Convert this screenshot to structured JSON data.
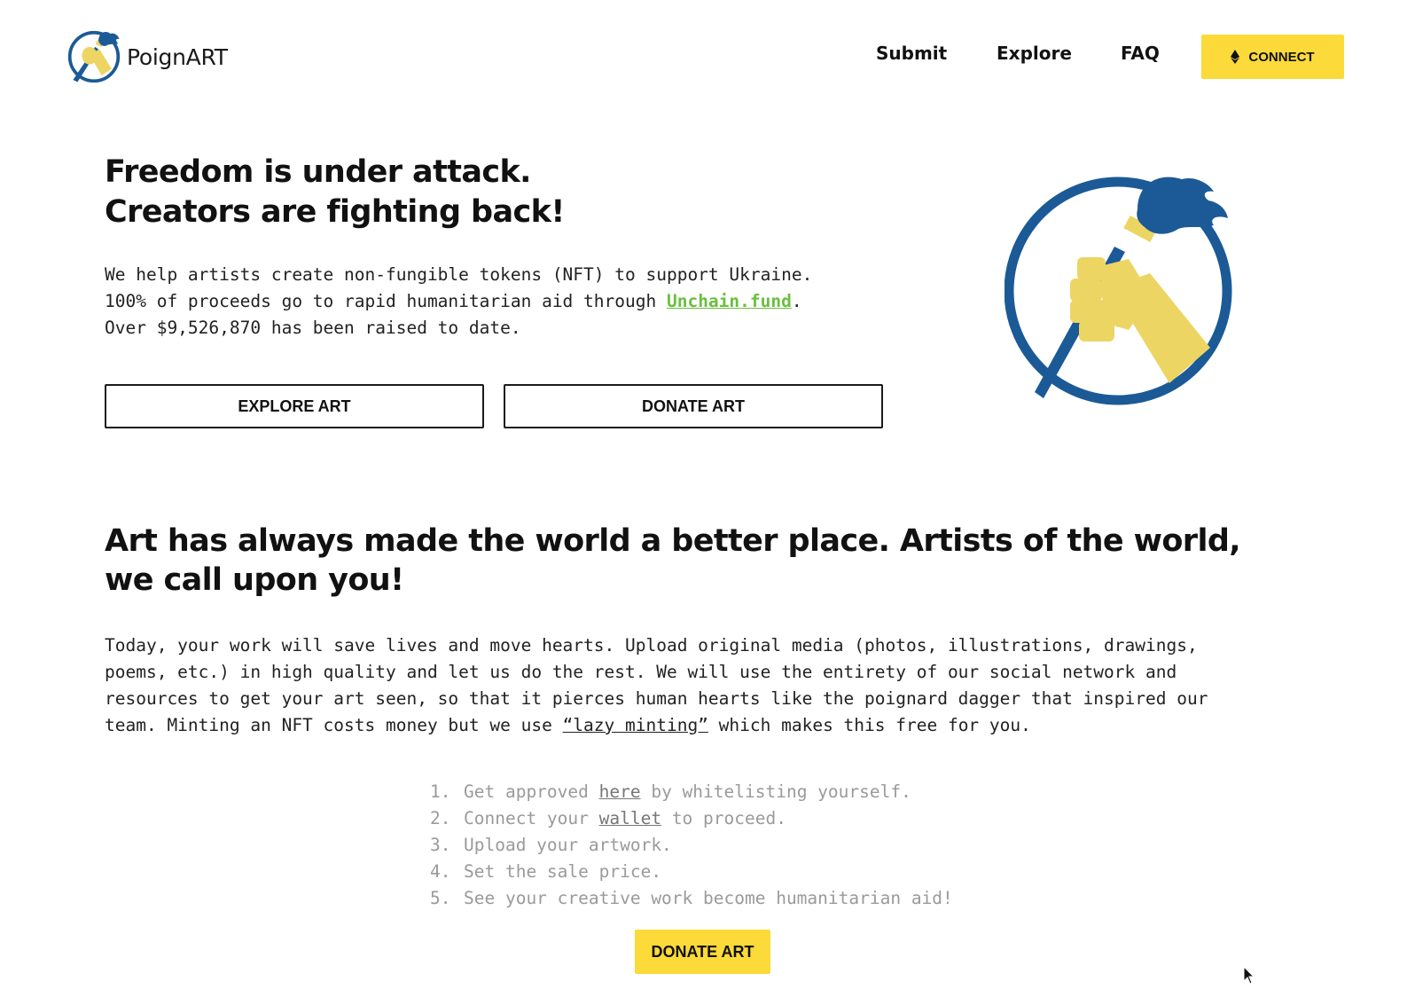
{
  "brand": {
    "name": "PoignART",
    "colors": {
      "blue": "#1b5a96",
      "yellow": "#ecd563",
      "button_yellow": "#fbda39",
      "link_green": "#6abf3f"
    }
  },
  "nav": {
    "links": [
      {
        "label": "Submit"
      },
      {
        "label": "Explore"
      },
      {
        "label": "FAQ"
      }
    ],
    "connect_label": "CONNECT",
    "connect_icon": "ethereum-icon"
  },
  "hero": {
    "title_line1": "Freedom is under attack.",
    "title_line2": "Creators are fighting back!",
    "text_line1": "We help artists create non-fungible tokens (NFT) to support Ukraine.",
    "text_line2_before": "100% of proceeds go to rapid humanitarian aid through ",
    "text_line2_link": "Unchain.fund",
    "text_line2_after": ".",
    "text_line3": "Over $9,526,870 has been raised to date.",
    "explore_button": "EXPLORE ART",
    "donate_button": "DONATE ART",
    "illustration": "torch-fist-logo"
  },
  "section": {
    "title": "Art has always made the world a better place. Artists of the world, we call upon you!",
    "para_line1": "Today, your work will save lives and move hearts. Upload original media (photos, illustrations, drawings,",
    "para_line2": "poems, etc.) in high quality and let us do the rest. We will use the entirety of our social network and",
    "para_line3": "resources to get your art seen, so that it pierces human hearts like the poignard dagger that inspired our",
    "para_line4_before": "team. Minting an NFT costs money but we use ",
    "para_line4_link": "“lazy minting”",
    "para_line4_after": " which makes this free for you."
  },
  "steps": [
    {
      "num": "1.",
      "before": "Get approved ",
      "link": "here",
      "after": " by whitelisting yourself."
    },
    {
      "num": "2.",
      "before": "Connect your ",
      "link": "wallet",
      "after": " to proceed."
    },
    {
      "num": "3.",
      "before": "Upload your artwork.",
      "link": "",
      "after": ""
    },
    {
      "num": "4.",
      "before": "Set the sale price.",
      "link": "",
      "after": ""
    },
    {
      "num": "5.",
      "before": "See your creative work become humanitarian aid!",
      "link": "",
      "after": ""
    }
  ],
  "donate_cta": "DONATE ART"
}
